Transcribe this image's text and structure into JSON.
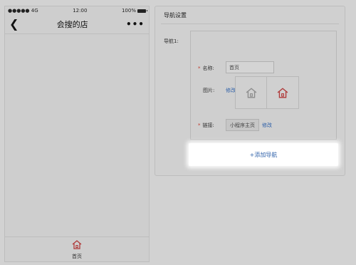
{
  "phone": {
    "status": {
      "carrier": "●●●●● 4G",
      "time": "12:00",
      "battery": "100%"
    },
    "title": "会搜的店",
    "more": "•••",
    "back": "❮",
    "tabbar": {
      "home_label": "首页"
    }
  },
  "panel": {
    "title": "导航设置",
    "nav_label": "导航1:",
    "name_label": "名称:",
    "name_value": "首页",
    "image_label": "图片:",
    "image_edit": "修改",
    "link_label": "链接:",
    "link_value": "小程序主页",
    "link_edit": "修改",
    "required_mark": "*",
    "add_button": "+添加导航"
  },
  "colors": {
    "accent": "#2c5fa8",
    "required": "#c0392b",
    "active_icon": "#b03a3a"
  }
}
